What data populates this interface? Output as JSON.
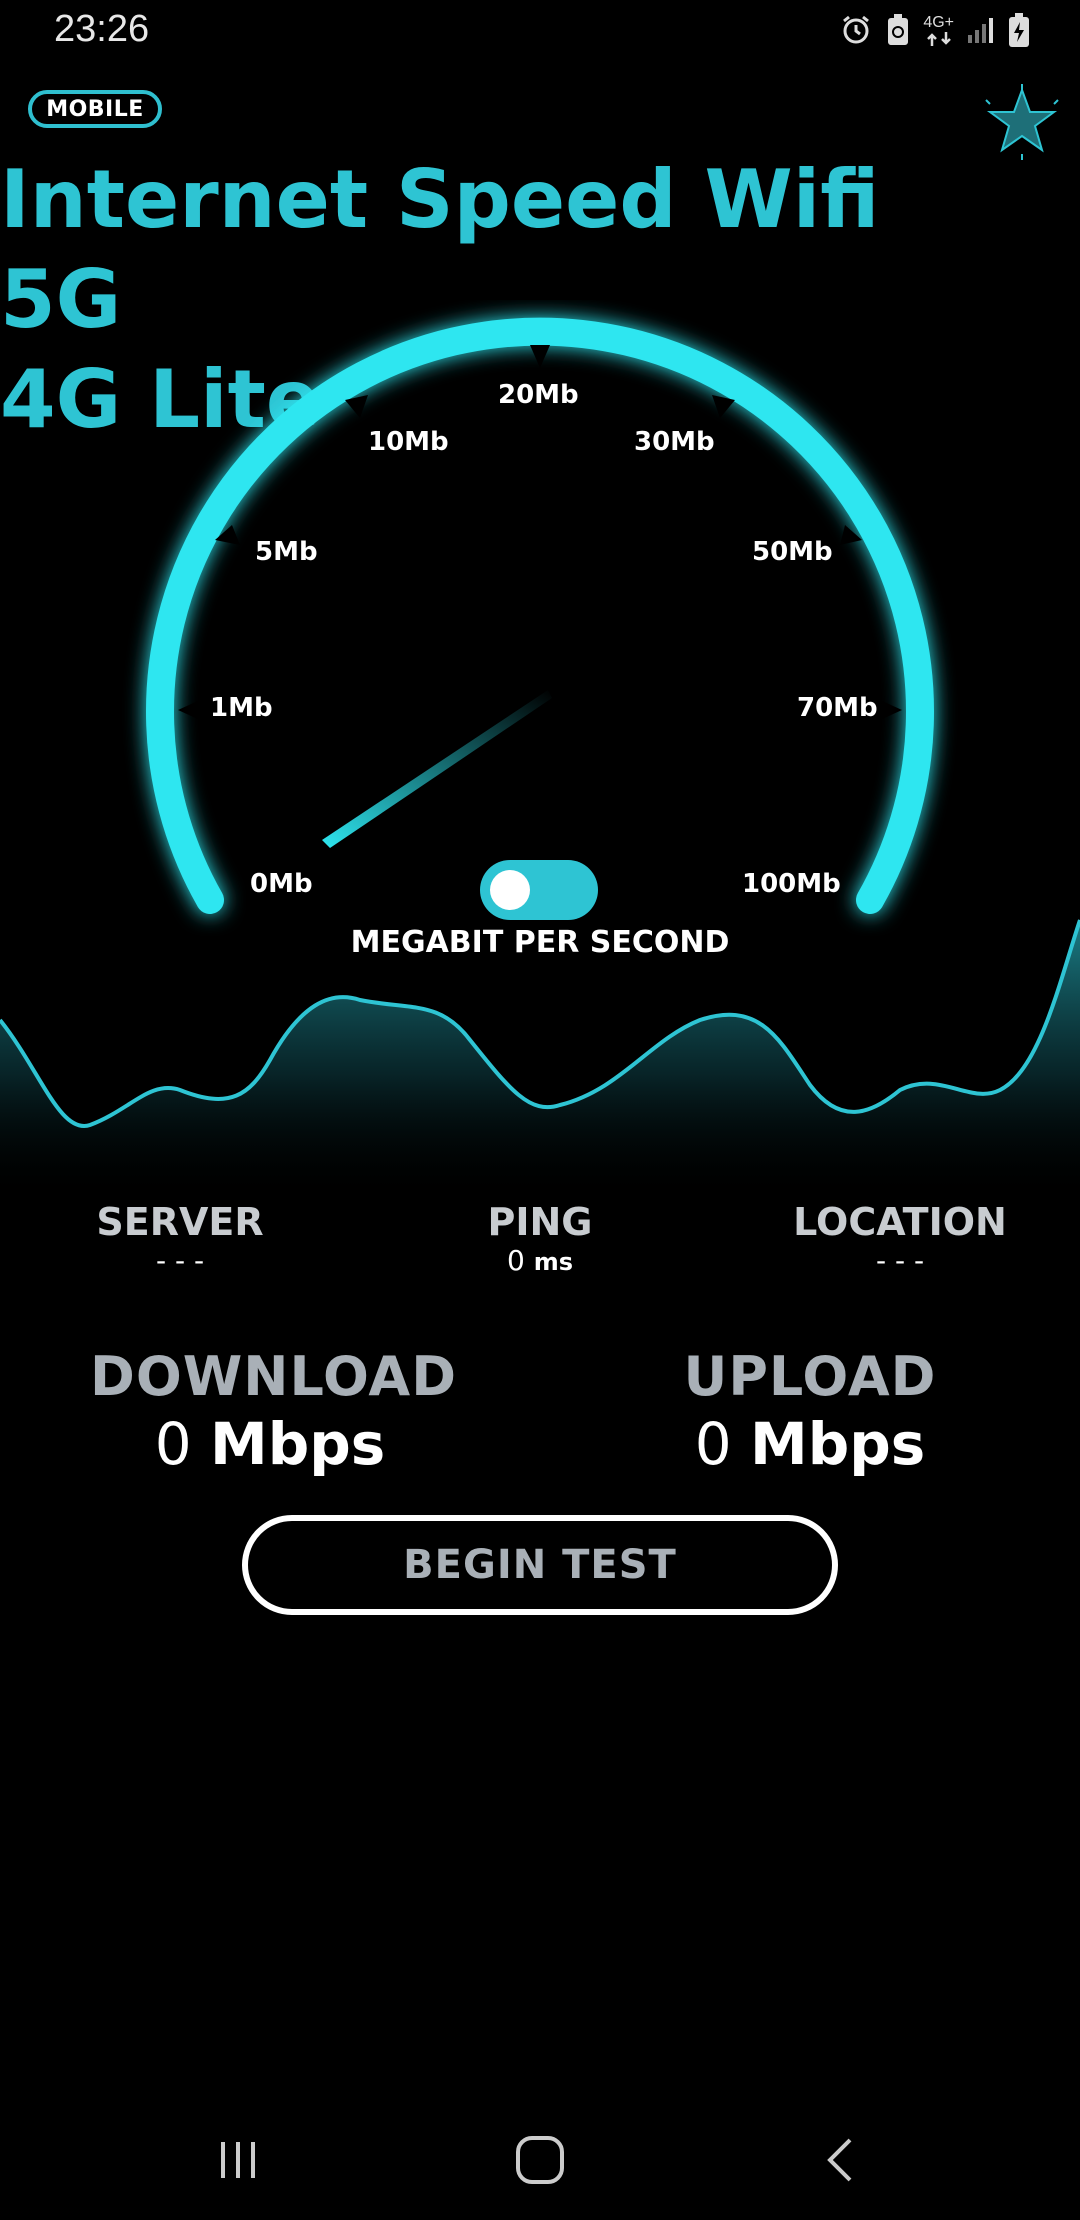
{
  "status_bar": {
    "time": "23:26",
    "network": "4G+",
    "icons": [
      "alarm-icon",
      "battery-saver-icon",
      "network-4g-icon",
      "signal-icon",
      "battery-charging-icon"
    ]
  },
  "header": {
    "badge": "MOBILE",
    "title_line1": "Internet Speed Wifi 5G",
    "title_line2": "4G Lite",
    "star_icon": "star-icon"
  },
  "gauge": {
    "ticks": [
      "0Mb",
      "1Mb",
      "5Mb",
      "10Mb",
      "20Mb",
      "30Mb",
      "50Mb",
      "70Mb",
      "100Mb"
    ],
    "unit_label": "MEGABIT PER SECOND",
    "needle_value": 0,
    "accent": "#2ee6f0"
  },
  "stats": {
    "server": {
      "label": "SERVER",
      "value": "- - -"
    },
    "ping": {
      "label": "PING",
      "value": "0",
      "unit": "ms"
    },
    "location": {
      "label": "LOCATION",
      "value": "- - -"
    }
  },
  "speeds": {
    "download": {
      "label": "DOWNLOAD",
      "value": "0",
      "unit": "Mbps"
    },
    "upload": {
      "label": "UPLOAD",
      "value": "0",
      "unit": "Mbps"
    }
  },
  "actions": {
    "begin_test": "BEGIN TEST"
  },
  "nav": {
    "recent": "recent-apps-icon",
    "home": "home-icon",
    "back": "back-icon"
  },
  "colors": {
    "accent": "#2ec4d3",
    "glow": "#2ee6f0",
    "background": "#000000"
  }
}
